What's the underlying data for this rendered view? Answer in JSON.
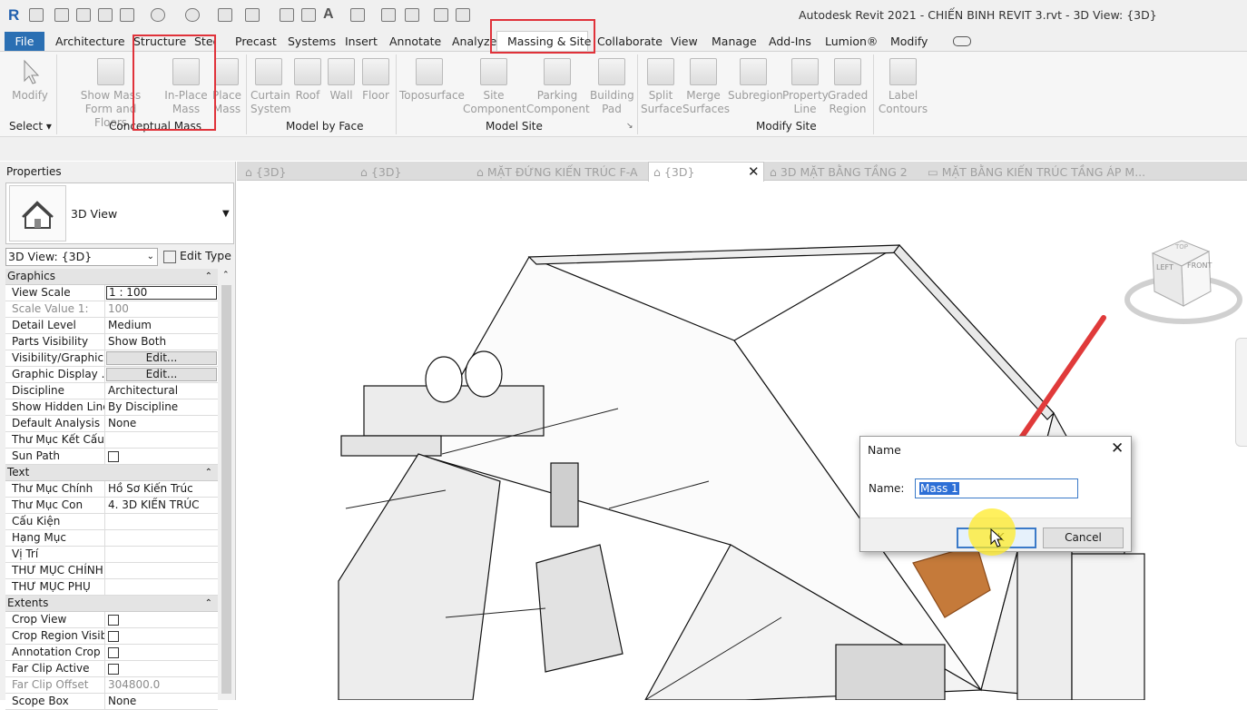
{
  "app": {
    "title": "Autodesk Revit 2021 - CHIẾN BINH REVIT 3.rvt - 3D View: {3D}"
  },
  "menu": {
    "file": "File",
    "tabs": [
      "Architecture",
      "Structure",
      "Steel",
      "Precast",
      "Systems",
      "Insert",
      "Annotate",
      "Analyze",
      "Massing & Site",
      "Collaborate",
      "View",
      "Manage",
      "Add-Ins",
      "Lumion®",
      "Modify"
    ],
    "active": "Massing & Site"
  },
  "ribbon": {
    "modify": {
      "label": "Modify",
      "panel": "Select"
    },
    "conceptual_mass": {
      "panel": "Conceptual Mass",
      "buttons": [
        "Show Mass Form and Floors",
        "In-Place Mass",
        "Place Mass"
      ]
    },
    "model_by_face": {
      "panel": "Model by Face",
      "buttons": [
        "Curtain System",
        "Roof",
        "Wall",
        "Floor"
      ]
    },
    "model_site": {
      "panel": "Model Site",
      "buttons": [
        "Toposurface",
        "Site Component",
        "Parking Component",
        "Building Pad"
      ]
    },
    "modify_site": {
      "panel": "Modify Site",
      "buttons": [
        "Split Surface",
        "Merge Surfaces",
        "Subregion",
        "Property Line",
        "Graded Region",
        "Label Contours"
      ]
    }
  },
  "properties": {
    "title": "Properties",
    "type_name": "3D View",
    "view_selector": "3D View: {3D}",
    "edit_type": "Edit Type",
    "sections": [
      {
        "name": "Graphics",
        "rows": [
          {
            "k": "View Scale",
            "v": "1 : 100",
            "kind": "input"
          },
          {
            "k": "Scale Value   1:",
            "v": "100",
            "kind": "grey"
          },
          {
            "k": "Detail Level",
            "v": "Medium"
          },
          {
            "k": "Parts Visibility",
            "v": "Show Both"
          },
          {
            "k": "Visibility/Graphic...",
            "v": "Edit...",
            "kind": "button"
          },
          {
            "k": "Graphic Display ...",
            "v": "Edit...",
            "kind": "button"
          },
          {
            "k": "Discipline",
            "v": "Architectural"
          },
          {
            "k": "Show Hidden Lines",
            "v": "By Discipline"
          },
          {
            "k": "Default Analysis ...",
            "v": "None"
          },
          {
            "k": "Thư Mục Kết Cấu",
            "v": ""
          },
          {
            "k": "Sun Path",
            "v": "",
            "kind": "check"
          }
        ]
      },
      {
        "name": "Text",
        "rows": [
          {
            "k": "Thư Mục Chính",
            "v": "Hồ Sơ Kiến Trúc"
          },
          {
            "k": "Thư Mục Con",
            "v": "4. 3D KIẾN TRÚC"
          },
          {
            "k": "Cấu Kiện",
            "v": ""
          },
          {
            "k": "Hạng Mục",
            "v": ""
          },
          {
            "k": "Vị Trí",
            "v": ""
          },
          {
            "k": "THƯ MỤC CHÍNH",
            "v": ""
          },
          {
            "k": "THƯ MỤC PHỤ",
            "v": ""
          }
        ]
      },
      {
        "name": "Extents",
        "rows": [
          {
            "k": "Crop View",
            "v": "",
            "kind": "check"
          },
          {
            "k": "Crop Region Visible",
            "v": "",
            "kind": "check"
          },
          {
            "k": "Annotation Crop",
            "v": "",
            "kind": "check"
          },
          {
            "k": "Far Clip Active",
            "v": "",
            "kind": "check"
          },
          {
            "k": "Far Clip Offset",
            "v": "304800.0",
            "kind": "grey"
          },
          {
            "k": "Scope Box",
            "v": "None"
          }
        ]
      }
    ]
  },
  "view_tabs": [
    "{3D}",
    "{3D}",
    "MẶT ĐỨNG KIẾN TRÚC F-A",
    "{3D}",
    "3D MẶT BẰNG TẦNG 2",
    "MẶT BẰNG KIẾN TRÚC TẦNG ÁP M..."
  ],
  "viewcube": {
    "left": "LEFT",
    "front": "FRONT",
    "top": "TOP"
  },
  "dialog": {
    "title": "Name",
    "close": "✕",
    "name_label": "Name:",
    "name_value": "Mass 1",
    "ok": "OK",
    "cancel": "Cancel"
  },
  "colors": {
    "accent": "#2a6fb3",
    "annotation": "#e0323a",
    "selection": "#2d6fd6"
  }
}
